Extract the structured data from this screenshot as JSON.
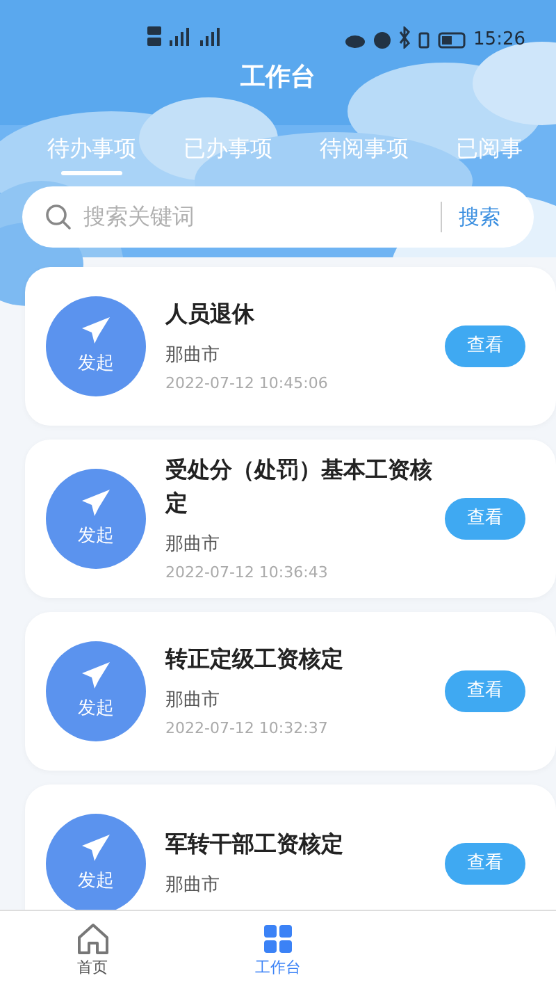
{
  "status_bar": {
    "time": "15:26"
  },
  "header": {
    "title": "工作台"
  },
  "tabs": [
    {
      "label": "待办事项",
      "selected": true
    },
    {
      "label": "已办事项",
      "selected": false
    },
    {
      "label": "待阅事项",
      "selected": false
    },
    {
      "label": "已阅事",
      "selected": false
    }
  ],
  "search": {
    "placeholder": "搜索关键词",
    "button": "搜索"
  },
  "items": [
    {
      "badge": "发起",
      "title": "人员退休",
      "location": "那曲市",
      "time": "2022-07-12 10:45:06",
      "action": "查看"
    },
    {
      "badge": "发起",
      "title": "受处分（处罚）基本工资核定",
      "location": "那曲市",
      "time": "2022-07-12 10:36:43",
      "action": "查看"
    },
    {
      "badge": "发起",
      "title": "转正定级工资核定",
      "location": "那曲市",
      "time": "2022-07-12 10:32:37",
      "action": "查看"
    },
    {
      "badge": "发起",
      "title": "军转干部工资核定",
      "location": "那曲市",
      "action": "查看"
    }
  ],
  "bottom_nav": [
    {
      "label": "首页",
      "kind": "home",
      "selected": false
    },
    {
      "label": "工作台",
      "kind": "work",
      "selected": true
    }
  ]
}
